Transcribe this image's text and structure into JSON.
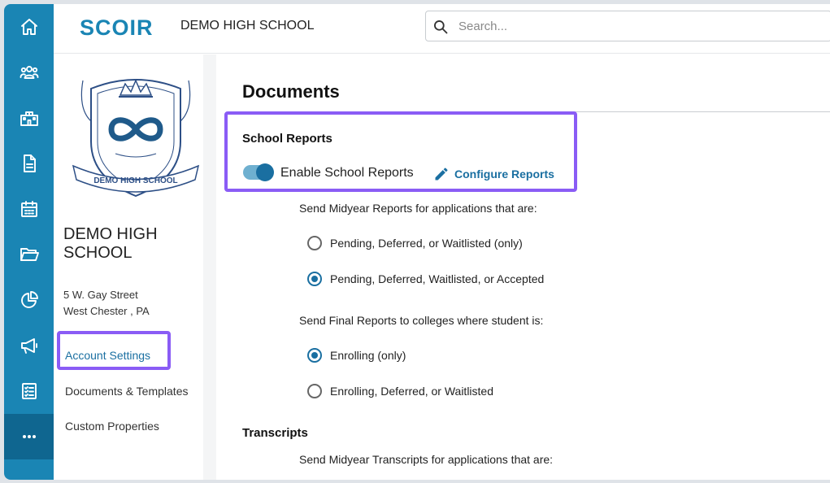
{
  "header": {
    "logo_text": "SCOIR",
    "school_name": "DEMO HIGH SCHOOL",
    "search_placeholder": "Search..."
  },
  "rail": {
    "items": [
      {
        "icon": "home-icon"
      },
      {
        "icon": "people-icon"
      },
      {
        "icon": "school-icon"
      },
      {
        "icon": "document-icon"
      },
      {
        "icon": "calendar-icon"
      },
      {
        "icon": "folder-icon"
      },
      {
        "icon": "pie-chart-icon"
      },
      {
        "icon": "megaphone-icon"
      },
      {
        "icon": "checklist-icon"
      },
      {
        "icon": "more-icon"
      }
    ]
  },
  "sidebar": {
    "crest_text": "DEMO HIGH SCHOOL",
    "school_title": "DEMO HIGH SCHOOL",
    "address_line1": "5 W. Gay Street",
    "address_line2": "West Chester , PA",
    "nav": [
      {
        "label": "Account Settings",
        "active": true
      },
      {
        "label": "Documents & Templates",
        "active": false
      },
      {
        "label": "Custom Properties",
        "active": false
      }
    ]
  },
  "main": {
    "title": "Documents",
    "school_reports": {
      "heading": "School Reports",
      "toggle_label": "Enable School Reports",
      "toggle_on": true,
      "configure_label": "Configure Reports",
      "midyear_question": "Send Midyear Reports for applications that are:",
      "midyear_options": [
        {
          "label": "Pending, Deferred, or Waitlisted (only)",
          "selected": false
        },
        {
          "label": "Pending, Deferred, Waitlisted, or Accepted",
          "selected": true
        }
      ],
      "final_question": "Send Final Reports to colleges where student is:",
      "final_options": [
        {
          "label": "Enrolling (only)",
          "selected": true
        },
        {
          "label": "Enrolling, Deferred, or Waitlisted",
          "selected": false
        }
      ]
    },
    "transcripts": {
      "heading": "Transcripts",
      "midyear_question": "Send Midyear Transcripts for applications that are:"
    }
  },
  "colors": {
    "brand": "#1a85b4",
    "accent": "#1a6fa1",
    "highlight": "#8a5cf5"
  }
}
